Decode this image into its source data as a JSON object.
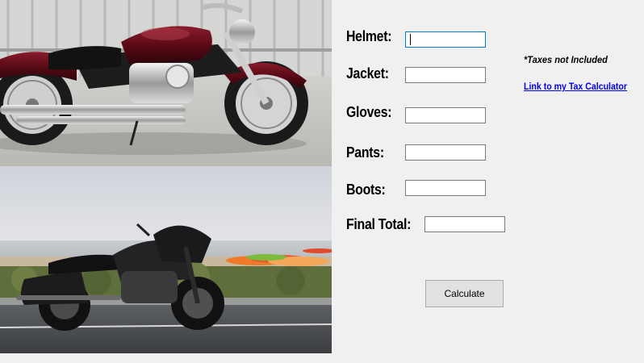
{
  "images": {
    "top": {
      "subject": "cruiser-motorcycle-dark-red"
    },
    "bottom": {
      "subject": "touring-motorcycle-black-seaside"
    }
  },
  "form": {
    "fields": [
      {
        "key": "helmet",
        "label": "Helmet:",
        "value": ""
      },
      {
        "key": "jacket",
        "label": "Jacket:",
        "value": ""
      },
      {
        "key": "gloves",
        "label": "Gloves:",
        "value": ""
      },
      {
        "key": "pants",
        "label": "Pants:",
        "value": ""
      },
      {
        "key": "boots",
        "label": "Boots:",
        "value": ""
      }
    ],
    "final_total": {
      "label": "Final Total:",
      "value": ""
    },
    "calculate_label": "Calculate"
  },
  "notes": {
    "tax_note": "*Taxes not Included",
    "tax_link": "Link to my Tax Calculator"
  },
  "colors": {
    "window_bg": "#f0f0f0",
    "link": "#0000ee",
    "focus_border": "#0078d7",
    "bike_top": "#5a0a16",
    "bike_bottom": "#1c1c1e"
  }
}
